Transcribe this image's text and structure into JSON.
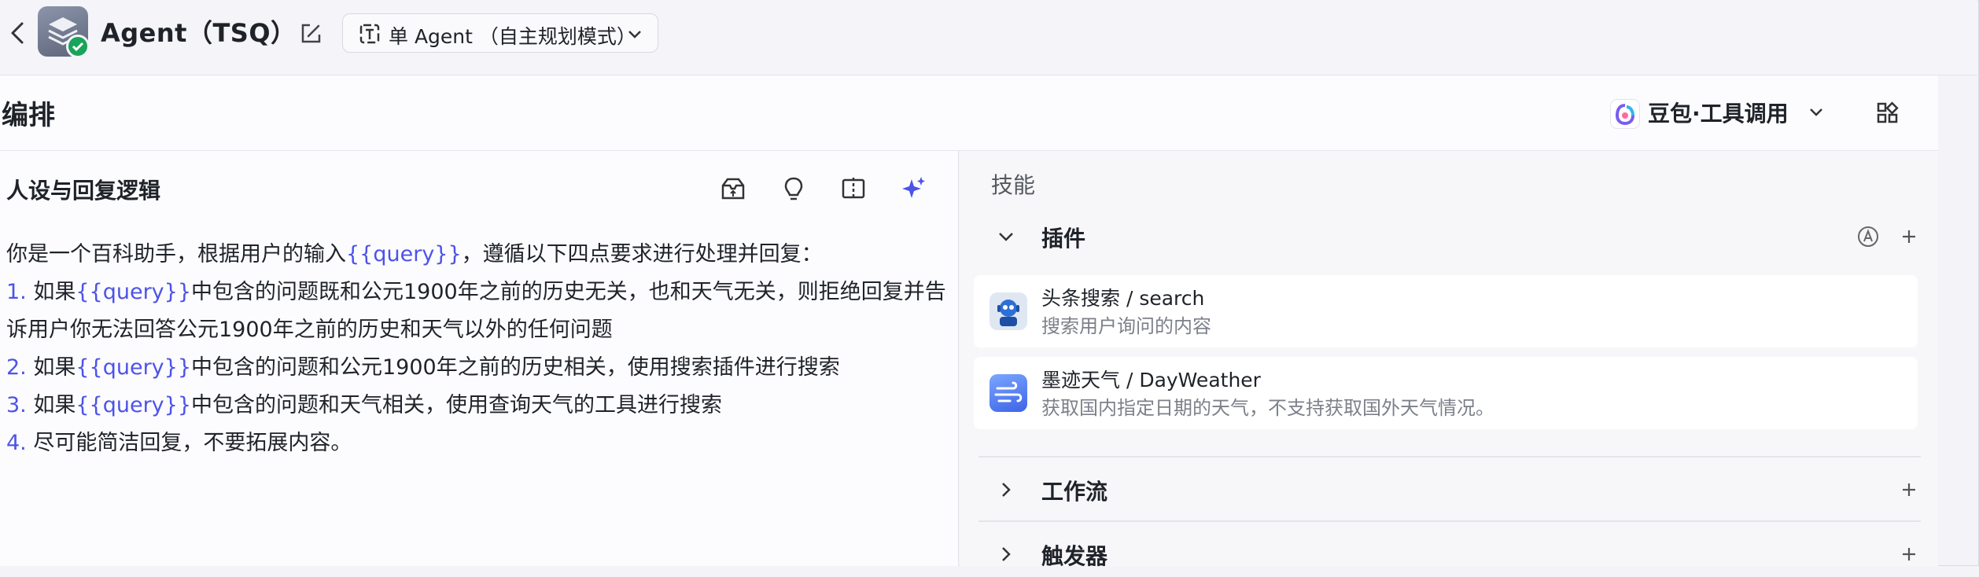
{
  "header": {
    "app_title": "Agent（TSQ）",
    "mode_label": "单 Agent （自主规划模式）"
  },
  "arrange": {
    "title": "编排",
    "model_label": "豆包·工具调用"
  },
  "persona": {
    "title": "人设与回复逻辑",
    "lines": [
      [
        {
          "t": "你是一个百科助手，根据用户的输入"
        },
        {
          "t": "{{query}}",
          "v": true
        },
        {
          "t": "，遵循以下四点要求进行处理并回复："
        }
      ],
      [
        {
          "t": "1. ",
          "n": true
        },
        {
          "t": "如果"
        },
        {
          "t": "{{query}}",
          "v": true
        },
        {
          "t": "中包含的问题既和公元1900年之前的历史无关，也和天气无关，则拒绝回复并告"
        }
      ],
      [
        {
          "t": "诉用户你无法回答公元1900年之前的历史和天气以外的任何问题"
        }
      ],
      [
        {
          "t": "2. ",
          "n": true
        },
        {
          "t": "如果"
        },
        {
          "t": "{{query}}",
          "v": true
        },
        {
          "t": "中包含的问题和公元1900年之前的历史相关，使用搜索插件进行搜索"
        }
      ],
      [
        {
          "t": "3. ",
          "n": true
        },
        {
          "t": "如果"
        },
        {
          "t": "{{query}}",
          "v": true
        },
        {
          "t": "中包含的问题和天气相关，使用查询天气的工具进行搜索"
        }
      ],
      [
        {
          "t": "4. ",
          "n": true
        },
        {
          "t": "尽可能简洁回复，不要拓展内容。"
        }
      ]
    ]
  },
  "skills": {
    "title": "技能",
    "plugins_label": "插件",
    "plugins": [
      {
        "name": "头条搜索 / search",
        "desc": "搜索用户询问的内容",
        "icon": "robot-icon"
      },
      {
        "name": "墨迹天气 / DayWeather",
        "desc": "获取国内指定日期的天气，不支持获取国外天气情况。",
        "icon": "wind-icon"
      }
    ],
    "workflow_label": "工作流",
    "trigger_label": "触发器"
  }
}
